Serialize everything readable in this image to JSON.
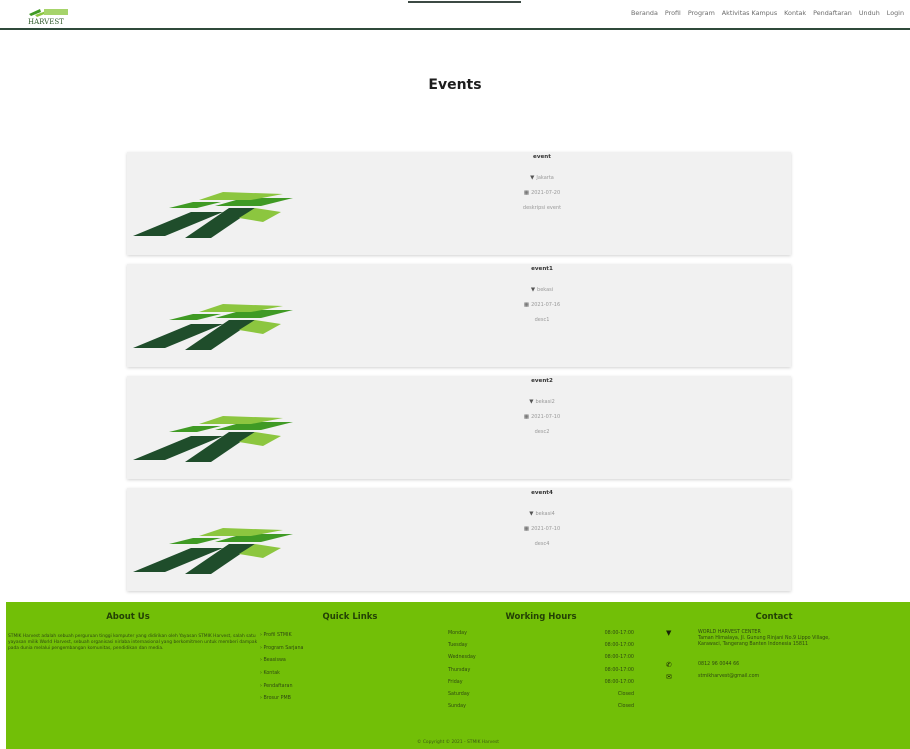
{
  "nav": {
    "logo_text": "HARVEST",
    "links": [
      "Beranda",
      "Profil",
      "Program",
      "Aktivitas Kampus",
      "Kontak",
      "Pendaftaran",
      "Unduh",
      "Login"
    ]
  },
  "page": {
    "title": "Events"
  },
  "events": [
    {
      "name": "event",
      "location": "Jakarta",
      "date": "2021-07-20",
      "description": "deskripsi event"
    },
    {
      "name": "event1",
      "location": "bekasi",
      "date": "2021-07-16",
      "description": "desc1"
    },
    {
      "name": "event2",
      "location": "bekasi2",
      "date": "2021-07-10",
      "description": "desc2"
    },
    {
      "name": "event4",
      "location": "bekasi4",
      "date": "2021-07-10",
      "description": "desc4"
    }
  ],
  "footer": {
    "about": {
      "title": "About Us",
      "text": "STMIK Harvest adalah sebuah perguruan tinggi komputer yang didirikan oleh Yayasan STMIK Harvest, salah satu yayasan milik World Harvest, sebuah organisasi nirlaba internasional yang berkomitmen untuk memberi dampak pada dunia melalui pengembangan komunitas, pendidikan dan media."
    },
    "quick_links": {
      "title": "Quick Links",
      "items": [
        "Profil STMIK",
        "Program Sarjana",
        "Beasiswa",
        "Kontak",
        "Pendaftaran",
        "Brosur PMB"
      ]
    },
    "working_hours": {
      "title": "Working Hours",
      "rows": [
        {
          "day": "Monday",
          "hours": "08:00-17:00"
        },
        {
          "day": "Tuesday",
          "hours": "08:00-17:00"
        },
        {
          "day": "Wednesday",
          "hours": "08:00-17:00"
        },
        {
          "day": "Thursday",
          "hours": "08:00-17:00"
        },
        {
          "day": "Friday",
          "hours": "08:00-17:00"
        },
        {
          "day": "Saturday",
          "hours": "Closed"
        },
        {
          "day": "Sunday",
          "hours": "Closed"
        }
      ]
    },
    "contact": {
      "title": "Contact",
      "address_name": "WORLD HARVEST CENTER",
      "address_line1": "Taman Himalaya, Jl. Gunung Rinjani No.9 Lippo Village,",
      "address_line2": "Karawaci, Tangerang Banten Indonesia 15811",
      "phone": "0812 96 0044 66",
      "email": "stmikharvest@gmail.com"
    },
    "copyright": "© Copyright © 2021 - STMIK Harvest"
  },
  "colors": {
    "brand_green": "#72bf07",
    "dark_green": "#1f4d2b",
    "mid_green": "#3f9a24",
    "lime": "#8cc63f"
  },
  "icons": {
    "location": "map-marker-icon",
    "date": "calendar-icon",
    "phone": "phone-icon",
    "email": "envelope-icon"
  }
}
